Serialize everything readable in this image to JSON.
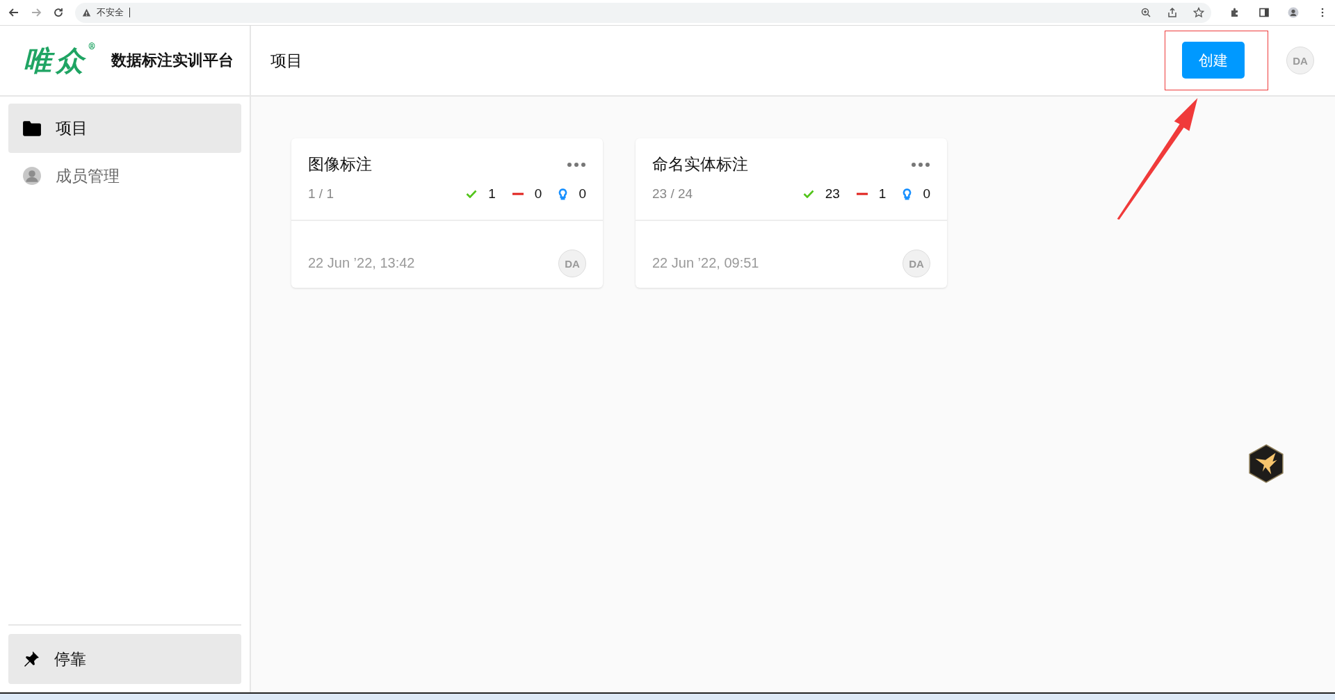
{
  "browser": {
    "security_label": "不安全"
  },
  "header": {
    "logo": "唯众",
    "logo_mark": "®",
    "app_title": "数据标注实训平台",
    "page_title": "项目",
    "create_button": "创建",
    "avatar": "DA"
  },
  "sidebar": {
    "items": [
      {
        "label": "项目",
        "kind": "folder",
        "selected": true
      },
      {
        "label": "成员管理",
        "kind": "person",
        "selected": false
      }
    ],
    "dock_button": "停靠"
  },
  "projects": [
    {
      "title": "图像标注",
      "progress": "1 / 1",
      "completed": "1",
      "skipped": "0",
      "predictions": "0",
      "date": "22 Jun ’22, 13:42",
      "avatar": "DA"
    },
    {
      "title": "命名实体标注",
      "progress": "23 / 24",
      "completed": "23",
      "skipped": "1",
      "predictions": "0",
      "date": "22 Jun ’22, 09:51",
      "avatar": "DA"
    }
  ]
}
